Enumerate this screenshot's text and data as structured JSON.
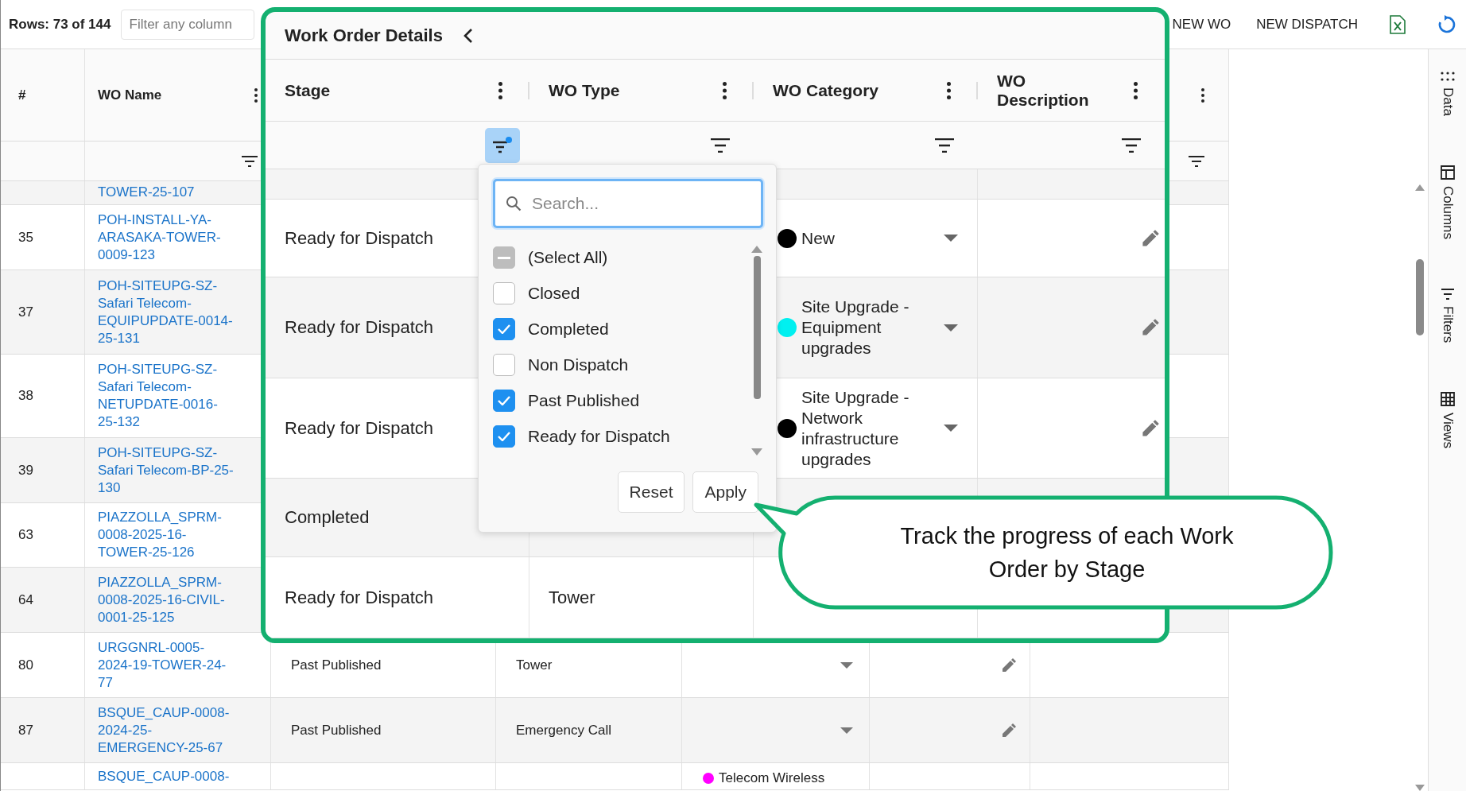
{
  "toolbar": {
    "row_count": "Rows: 73 of 144",
    "filter": {
      "placeholder": "Filter any column"
    },
    "actions": [
      "NEW WO",
      "NEW DISPATCH"
    ]
  },
  "grid": {
    "columns": [
      {
        "label": "#"
      },
      {
        "label": "WO Name"
      }
    ],
    "rows": [
      {
        "name": "TOWER-25-107",
        "kind": "partial"
      },
      {
        "number": "35",
        "name": "POH-INSTALL-YA-ARASAKA-TOWER-0009-123",
        "kind": "full"
      },
      {
        "number": "37",
        "name": "POH-SITEUPG-SZ-Safari Telecom-EQUIPUPDATE-0014-25-131",
        "kind": "full"
      },
      {
        "number": "38",
        "name": "POH-SITEUPG-SZ-Safari Telecom-NETUPDATE-0016-25-132",
        "kind": "full"
      },
      {
        "number": "39",
        "name": "POH-SITEUPG-SZ-Safari Telecom-BP-25-130",
        "kind": "full"
      },
      {
        "number": "63",
        "name": "PIAZZOLLA_SPRM-0008-2025-16-TOWER-25-126",
        "kind": "full"
      },
      {
        "number": "64",
        "name": "PIAZZOLLA_SPRM-0008-2025-16-CIVIL-0001-25-125",
        "kind": "full"
      },
      {
        "number": "80",
        "name": "URGGNRL-0005-2024-19-TOWER-24-77",
        "stage": "Past Published",
        "type": "Tower",
        "kind": "full"
      },
      {
        "number": "87",
        "name": "BSQUE_CAUP-0008-2024-25-EMERGENCY-25-67",
        "stage": "Past Published",
        "type": "Emergency Call",
        "kind": "full"
      },
      {
        "name": "BSQUE_CAUP-0008-",
        "category": "Telecom Wireless",
        "color": "#ff00ff",
        "kind": "cut"
      }
    ]
  },
  "side_panel": {
    "tabs": [
      {
        "label": "Data",
        "kind": "grip"
      },
      {
        "label": "Columns",
        "kind": "columns"
      },
      {
        "label": "Filters",
        "kind": "filter"
      },
      {
        "label": "Views",
        "kind": "table"
      }
    ]
  },
  "zoom_panel": {
    "title": "Work Order Details",
    "columns": [
      {
        "label": "Stage",
        "filter_active": true
      },
      {
        "label": "WO Type",
        "filter_active": false
      },
      {
        "label": "WO Category",
        "filter_active": false
      },
      {
        "label": "WO Description",
        "filter_active": false
      }
    ],
    "rows": [
      {
        "stage": "Ready for Dispatch",
        "category": "New",
        "color": "#000000"
      },
      {
        "stage": "Ready for Dispatch",
        "category": "Site Upgrade - Equipment upgrades",
        "color": "#00f0f0"
      },
      {
        "stage": "Ready for Dispatch",
        "category": "Site Upgrade - Network infrastructure upgrades",
        "color": "#000000"
      },
      {
        "stage": "Completed"
      },
      {
        "stage": "Ready for Dispatch",
        "type": "Tower"
      }
    ]
  },
  "stage_filter": {
    "search": {
      "placeholder": "Search..."
    },
    "options": [
      {
        "label": "(Select All)",
        "checked": false,
        "indeterminate": true
      },
      {
        "label": "Closed",
        "checked": false,
        "indeterminate": false
      },
      {
        "label": "Completed",
        "checked": true,
        "indeterminate": false
      },
      {
        "label": "Non Dispatch",
        "checked": false,
        "indeterminate": false
      },
      {
        "label": "Past Published",
        "checked": true,
        "indeterminate": false
      },
      {
        "label": "Ready for Dispatch",
        "checked": true,
        "indeterminate": false
      }
    ],
    "buttons": [
      "Reset",
      "Apply"
    ]
  },
  "callout": {
    "text": "Track the progress of each Work Order by Stage"
  }
}
